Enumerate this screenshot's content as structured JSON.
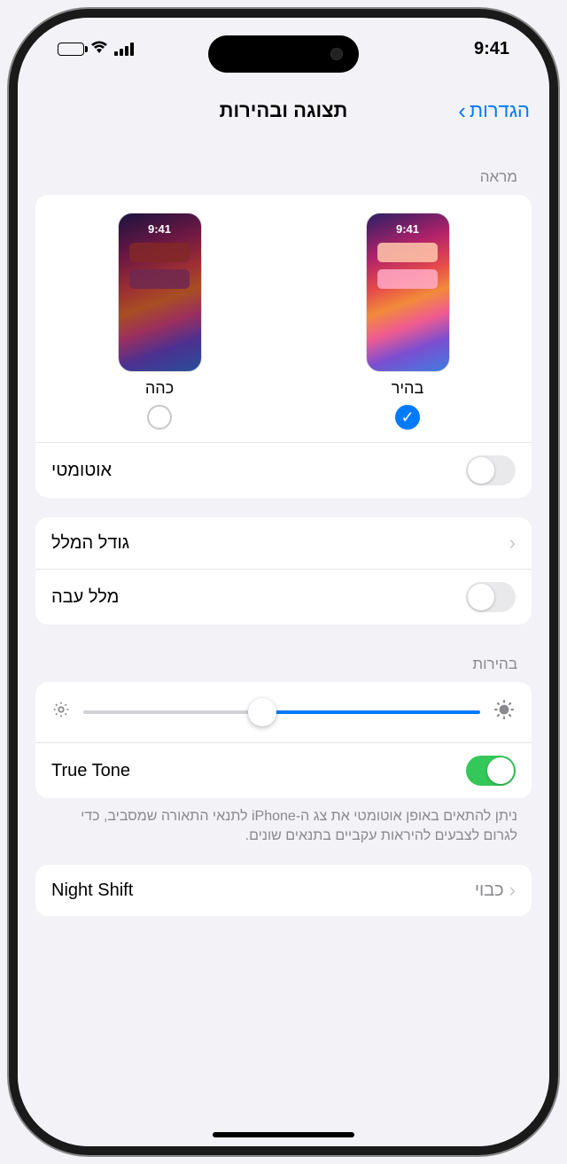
{
  "status": {
    "time": "9:41"
  },
  "nav": {
    "title": "תצוגה ובהירות",
    "back": "הגדרות"
  },
  "sections": {
    "appearance_header": "מראה",
    "brightness_header": "בהירות"
  },
  "appearance": {
    "light": {
      "label": "בהיר",
      "preview_time": "9:41",
      "selected": true
    },
    "dark": {
      "label": "כהה",
      "preview_time": "9:41",
      "selected": false
    },
    "automatic_label": "אוטומטי",
    "automatic_on": false
  },
  "text": {
    "text_size_label": "גודל המלל",
    "bold_text_label": "מלל עבה",
    "bold_text_on": false
  },
  "brightness": {
    "value_percent": 55,
    "true_tone_label": "True Tone",
    "true_tone_on": true,
    "true_tone_footer": "ניתן להתאים באופן אוטומטי את צג ה‑iPhone לתנאי התאורה שמסביב, כדי לגרום לצבעים להיראות עקביים בתנאים שונים."
  },
  "night_shift": {
    "label": "Night Shift",
    "value": "כבוי"
  }
}
